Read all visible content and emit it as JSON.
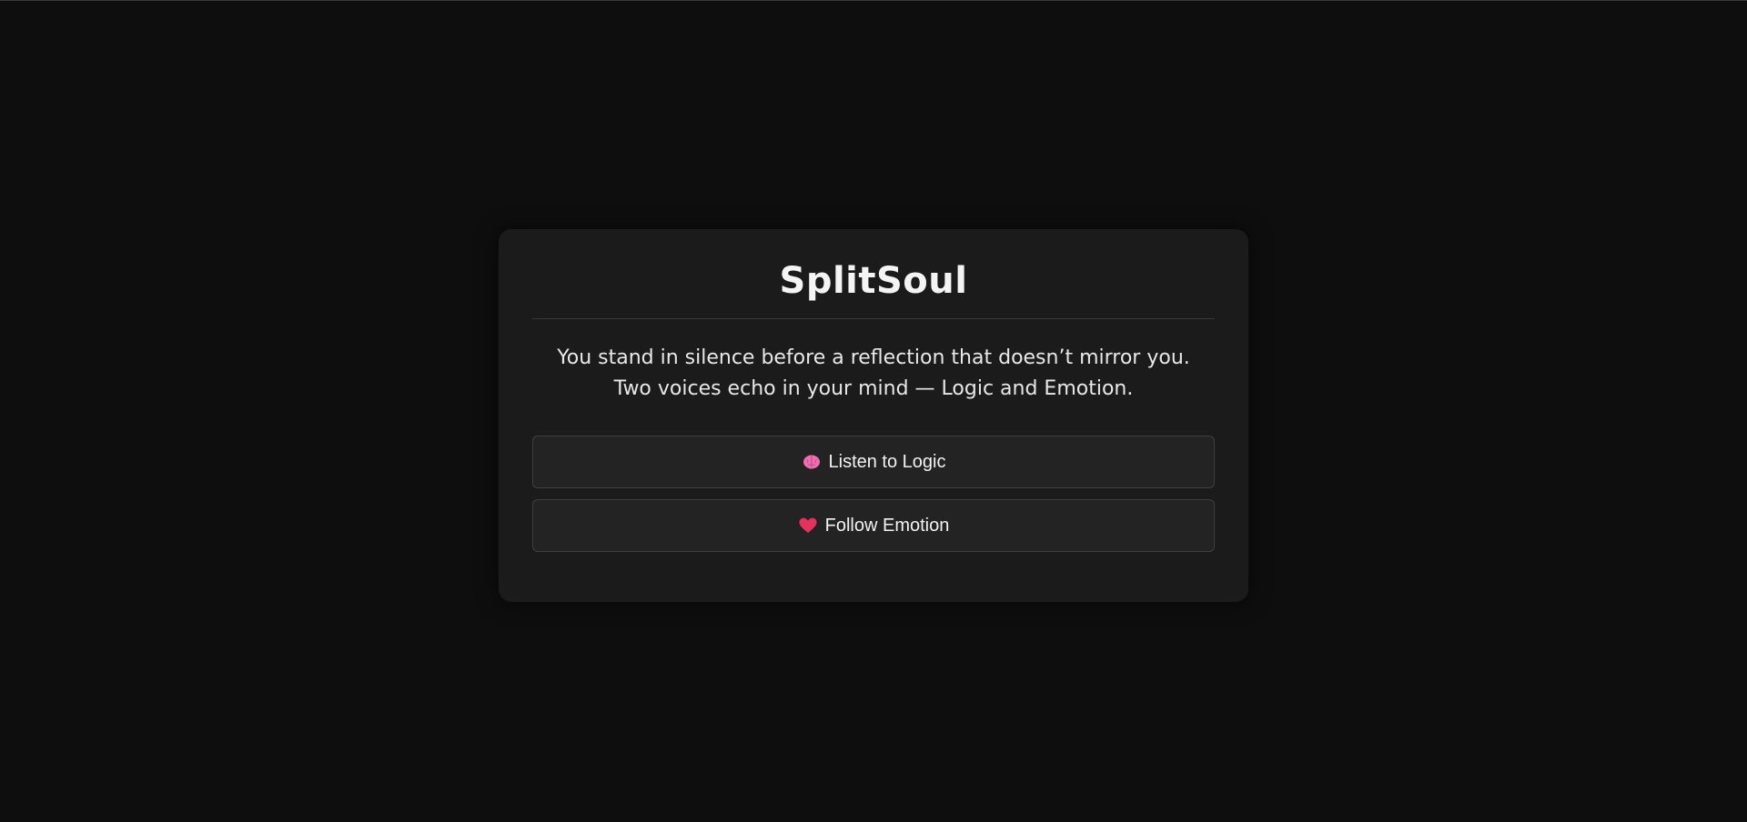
{
  "app": {
    "title": "SplitSoul"
  },
  "story": {
    "line1": "You stand in silence before a reflection that doesn’t mirror you.",
    "line2": "Two voices echo in your mind — Logic and Emotion."
  },
  "choices": [
    {
      "label": "Listen to Logic",
      "icon": "brain-icon",
      "icon_color": "#f06fb0"
    },
    {
      "label": "Follow Emotion",
      "icon": "heart-icon",
      "icon_color": "#e8315a"
    }
  ],
  "colors": {
    "background": "#0e0e0e",
    "card": "#1b1b1b",
    "button": "#232323",
    "button_border": "#3f3f3f",
    "text": "#f4f4f4"
  }
}
